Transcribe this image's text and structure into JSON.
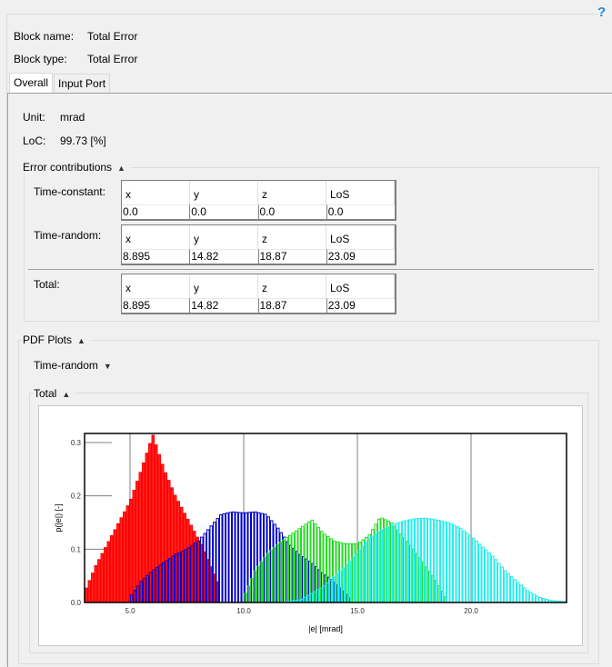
{
  "header": {
    "help_icon": "?",
    "block_name_label": "Block name:",
    "block_name_value": "Total Error",
    "block_type_label": "Block type:",
    "block_type_value": "Total Error"
  },
  "tabs": [
    {
      "label": "Overall",
      "active": true
    },
    {
      "label": "Input Port",
      "active": false
    }
  ],
  "overall": {
    "unit_label": "Unit:",
    "unit_value": "mrad",
    "loc_label": "LoC:",
    "loc_value": "99.73 [%]"
  },
  "error_contributions": {
    "title": "Error contributions",
    "expanded_icon": "triangle-up-icon",
    "columns": [
      "x",
      "y",
      "z",
      "LoS"
    ],
    "rows": [
      {
        "label": "Time-constant:",
        "values": [
          "0.0",
          "0.0",
          "0.0",
          "0.0"
        ]
      },
      {
        "label": "Time-random:",
        "values": [
          "8.895",
          "14.82",
          "18.87",
          "23.09"
        ]
      },
      {
        "label": "Total:",
        "values": [
          "8.895",
          "14.82",
          "18.87",
          "23.09"
        ]
      }
    ]
  },
  "pdf_plots": {
    "title": "PDF Plots",
    "time_random": {
      "title": "Time-random",
      "expanded": false
    },
    "total": {
      "title": "Total",
      "expanded": true
    }
  },
  "chart_data": {
    "type": "bar",
    "title": "",
    "xlabel": "|e| [mrad]",
    "ylabel": "p(|e|) [-]",
    "xlim": [
      3.0,
      24.2
    ],
    "ylim": [
      0.0,
      0.317
    ],
    "xticks": [
      "5.0",
      "10.0",
      "15.0",
      "20.0"
    ],
    "yticks": [
      "0.0",
      "0.1",
      "0.2",
      "0.3"
    ],
    "grid": "vertical lines at x ticks",
    "series": [
      {
        "name": "x",
        "color": "#ff0000",
        "fill": true,
        "x": [
          3.0,
          3.5,
          4.0,
          4.5,
          5.0,
          5.5,
          6.0,
          6.5,
          7.0,
          7.5,
          8.0,
          8.5,
          8.9
        ],
        "values": [
          0.02,
          0.07,
          0.11,
          0.15,
          0.19,
          0.25,
          0.315,
          0.25,
          0.2,
          0.16,
          0.12,
          0.07,
          0.03
        ]
      },
      {
        "name": "y",
        "color": "#0000cc",
        "fill": false,
        "x": [
          5.0,
          5.5,
          6.0,
          6.5,
          7.0,
          7.5,
          8.0,
          8.5,
          9.0,
          9.5,
          10.0,
          10.5,
          11.0,
          11.5,
          12.0,
          12.5,
          13.0,
          13.5,
          14.0,
          14.5,
          14.8
        ],
        "values": [
          0.01,
          0.04,
          0.06,
          0.075,
          0.09,
          0.1,
          0.115,
          0.14,
          0.165,
          0.17,
          0.168,
          0.17,
          0.165,
          0.14,
          0.11,
          0.09,
          0.075,
          0.055,
          0.04,
          0.02,
          0.005
        ]
      },
      {
        "name": "z",
        "color": "#22dd22",
        "fill": false,
        "x": [
          10.0,
          10.5,
          11.0,
          11.5,
          12.0,
          12.5,
          13.0,
          13.5,
          14.0,
          14.5,
          15.0,
          15.5,
          16.0,
          16.5,
          17.0,
          17.5,
          18.0,
          18.5,
          18.9
        ],
        "values": [
          0.01,
          0.06,
          0.09,
          0.11,
          0.125,
          0.14,
          0.155,
          0.13,
          0.115,
          0.11,
          0.11,
          0.125,
          0.16,
          0.15,
          0.125,
          0.1,
          0.07,
          0.04,
          0.01
        ]
      },
      {
        "name": "LoS",
        "color": "#22eeee",
        "fill": false,
        "x": [
          11.5,
          12.5,
          13.5,
          14.5,
          15.0,
          15.5,
          16.0,
          16.5,
          17.0,
          17.5,
          18.0,
          18.5,
          19.0,
          19.5,
          20.0,
          20.5,
          21.0,
          21.5,
          22.0,
          22.5,
          23.0,
          23.5,
          24.2
        ],
        "values": [
          0.0,
          0.005,
          0.03,
          0.07,
          0.095,
          0.12,
          0.135,
          0.145,
          0.152,
          0.157,
          0.158,
          0.155,
          0.15,
          0.14,
          0.125,
          0.105,
          0.085,
          0.06,
          0.04,
          0.022,
          0.01,
          0.004,
          0.001
        ]
      }
    ]
  }
}
